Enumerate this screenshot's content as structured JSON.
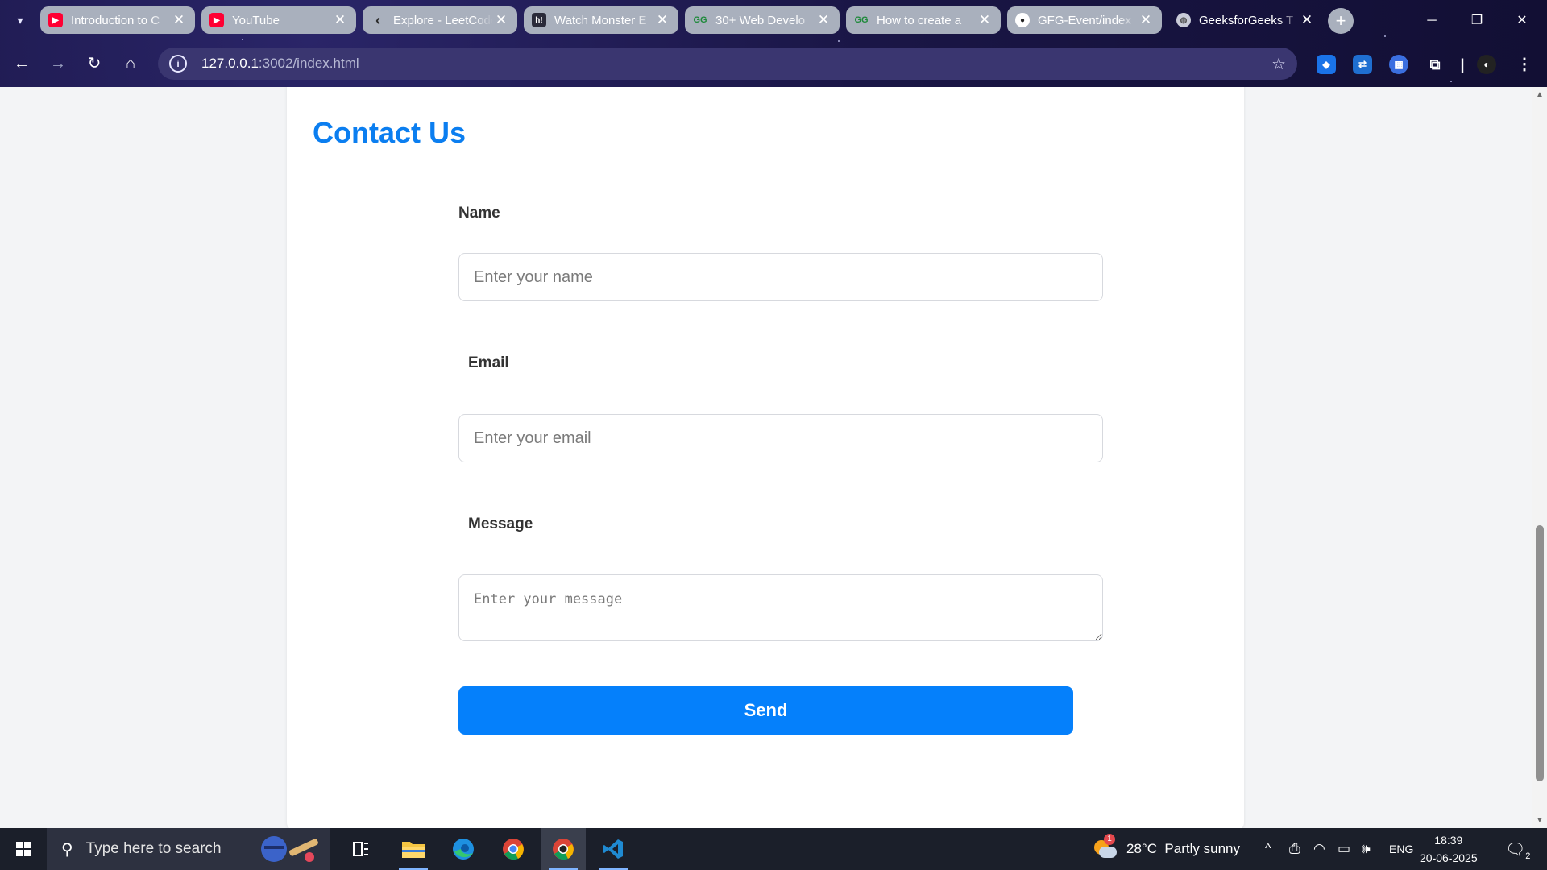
{
  "browser": {
    "tabs": [
      {
        "title": "Introduction to C",
        "favicon": "youtube-icon",
        "active": false
      },
      {
        "title": "YouTube",
        "favicon": "youtube-icon",
        "active": false
      },
      {
        "title": "Explore - LeetCode",
        "favicon": "leetcode-icon",
        "active": false
      },
      {
        "title": "Watch Monster E",
        "favicon": "hianime-icon",
        "active": false
      },
      {
        "title": "30+ Web Develo",
        "favicon": "geeksforgeeks-icon",
        "active": false
      },
      {
        "title": "How to create a",
        "favicon": "geeksforgeeks-icon",
        "active": false
      },
      {
        "title": "GFG-Event/index",
        "favicon": "github-icon",
        "active": false
      },
      {
        "title": "GeeksforGeeks T",
        "favicon": "globe-icon",
        "active": true
      }
    ],
    "address_host": "127.0.0.1",
    "address_path": ":3002/index.html"
  },
  "page": {
    "title": "Contact Us",
    "form": {
      "name_label": "Name",
      "name_placeholder": "Enter your name",
      "email_label": "Email",
      "email_placeholder": "Enter your email",
      "message_label": "Message",
      "message_placeholder": "Enter your message",
      "send_label": "Send"
    }
  },
  "taskbar": {
    "search_placeholder": "Type here to search",
    "weather": "28°C  Partly sunny",
    "weather_badge": "1",
    "language": "ENG",
    "time": "18:39",
    "date": "20-06-2025",
    "notification_count": "2"
  },
  "colors": {
    "accent": "#0580fb",
    "title": "#0b7ef0",
    "chrome_bg": "#1a1646"
  }
}
